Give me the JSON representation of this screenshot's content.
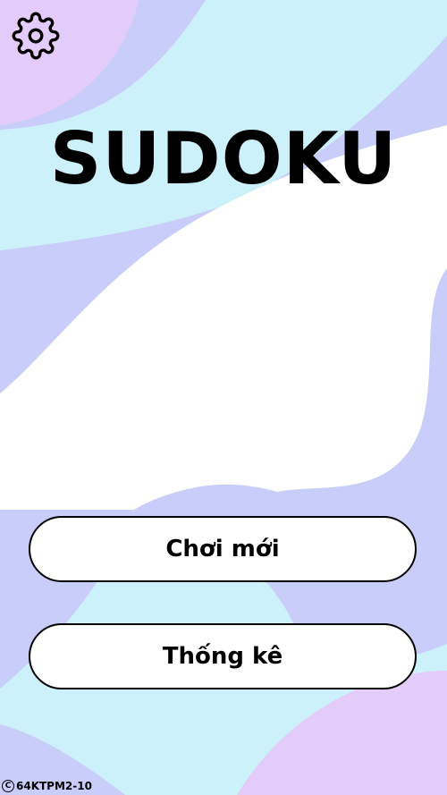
{
  "app": {
    "title": "SUDOKU"
  },
  "menu": {
    "new_game_label": "Chơi mới",
    "stats_label": "Thống kê"
  },
  "settings": {
    "icon": "gear-icon"
  },
  "footer": {
    "copyright_symbol": "C",
    "credit": "64KTPM2-10"
  },
  "colors": {
    "lavender": "#c9cdf9",
    "pink_lilac": "#e4ccfa",
    "light_cyan": "#cdf1fa",
    "white": "#ffffff",
    "text": "#000000"
  }
}
